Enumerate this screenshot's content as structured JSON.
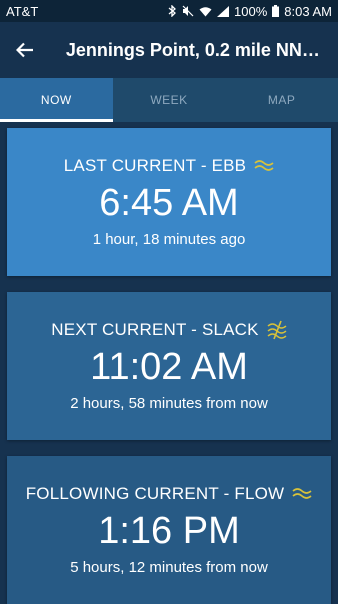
{
  "status": {
    "carrier": "AT&T",
    "battery": "100%",
    "time": "8:03 AM",
    "icons": [
      "bluetooth-icon",
      "mute-icon",
      "wifi-icon",
      "signal-icon",
      "battery-icon"
    ]
  },
  "appbar": {
    "title": "Jennings Point, 0.2 mile NNW...",
    "back_icon": "arrow-left-icon"
  },
  "tabs": [
    {
      "label": "NOW",
      "active": true
    },
    {
      "label": "WEEK",
      "active": false
    },
    {
      "label": "MAP",
      "active": false
    }
  ],
  "colors": {
    "accent_yellow": "#d8c23a",
    "card_light": "#3a87c8",
    "card_mid": "#2c6594"
  },
  "cards": [
    {
      "title": "LAST CURRENT - EBB",
      "time": "6:45 AM",
      "relative": "1 hour, 18 minutes ago",
      "icon": "ebb-waves-icon"
    },
    {
      "title": "NEXT CURRENT - SLACK",
      "time": "11:02 AM",
      "relative": "2 hours, 58 minutes from now",
      "icon": "slack-waves-icon"
    },
    {
      "title": "FOLLOWING CURRENT - FLOW",
      "time": "1:16 PM",
      "relative": "5 hours, 12 minutes from now",
      "icon": "flow-waves-icon"
    }
  ]
}
